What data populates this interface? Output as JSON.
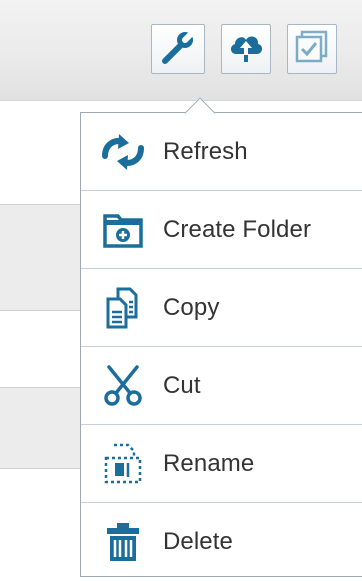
{
  "toolbar": {
    "buttons": [
      {
        "icon": "wrench-icon",
        "state": "active"
      },
      {
        "icon": "cloud-upload-icon",
        "state": "normal"
      },
      {
        "icon": "select-all-checkbox-icon",
        "state": "disabled"
      }
    ]
  },
  "menu": {
    "items": [
      {
        "label": "Refresh",
        "icon": "refresh-icon"
      },
      {
        "label": "Create Folder",
        "icon": "create-folder-icon"
      },
      {
        "label": "Copy",
        "icon": "copy-icon"
      },
      {
        "label": "Cut",
        "icon": "scissors-icon"
      },
      {
        "label": "Rename",
        "icon": "rename-icon"
      },
      {
        "label": "Delete",
        "icon": "trash-icon"
      }
    ]
  },
  "colors": {
    "icon_blue": "#1b6e9c",
    "menu_border": "#9fa9b1",
    "text": "#333333"
  }
}
